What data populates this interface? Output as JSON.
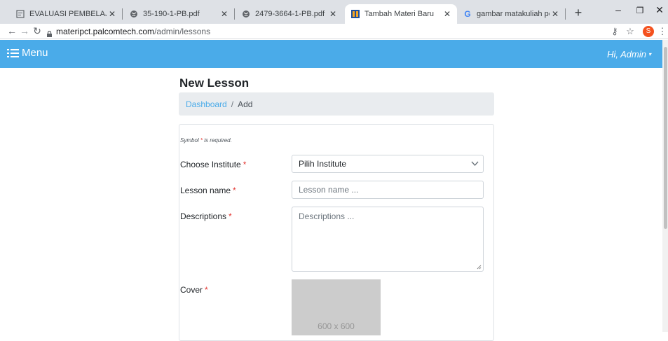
{
  "browser": {
    "tabs": [
      {
        "title": "EVALUASI PEMBELAJARAN MA",
        "icon": "document-icon"
      },
      {
        "title": "35-190-1-PB.pdf",
        "icon": "globe-icon"
      },
      {
        "title": "2479-3664-1-PB.pdf",
        "icon": "globe-icon"
      },
      {
        "title": "Tambah Materi Baru",
        "icon": "site-favicon",
        "active": true
      },
      {
        "title": "gambar matakuliah perpajakan",
        "icon": "google-icon"
      }
    ],
    "url_host": "materipct.palcomtech.com",
    "url_path": "/admin/lessons",
    "profile_initial": "S"
  },
  "navbar": {
    "menu_label": "Menu",
    "greeting": "Hi, Admin",
    "color": "#4aabe9"
  },
  "page": {
    "title": "New Lesson",
    "breadcrumb": {
      "link": "Dashboard",
      "separator": "/",
      "current": "Add"
    },
    "required_note": {
      "prefix": "Symbol",
      "star": "*",
      "suffix": "is required."
    },
    "fields": {
      "institute": {
        "label": "Choose Institute",
        "value": "Pilih Institute"
      },
      "lesson_name": {
        "label": "Lesson name",
        "placeholder": "Lesson name ..."
      },
      "descriptions": {
        "label": "Descriptions",
        "placeholder": "Descriptions ..."
      },
      "cover": {
        "label": "Cover",
        "placeholder_text": "600 x 600"
      }
    },
    "required_star": "*"
  }
}
